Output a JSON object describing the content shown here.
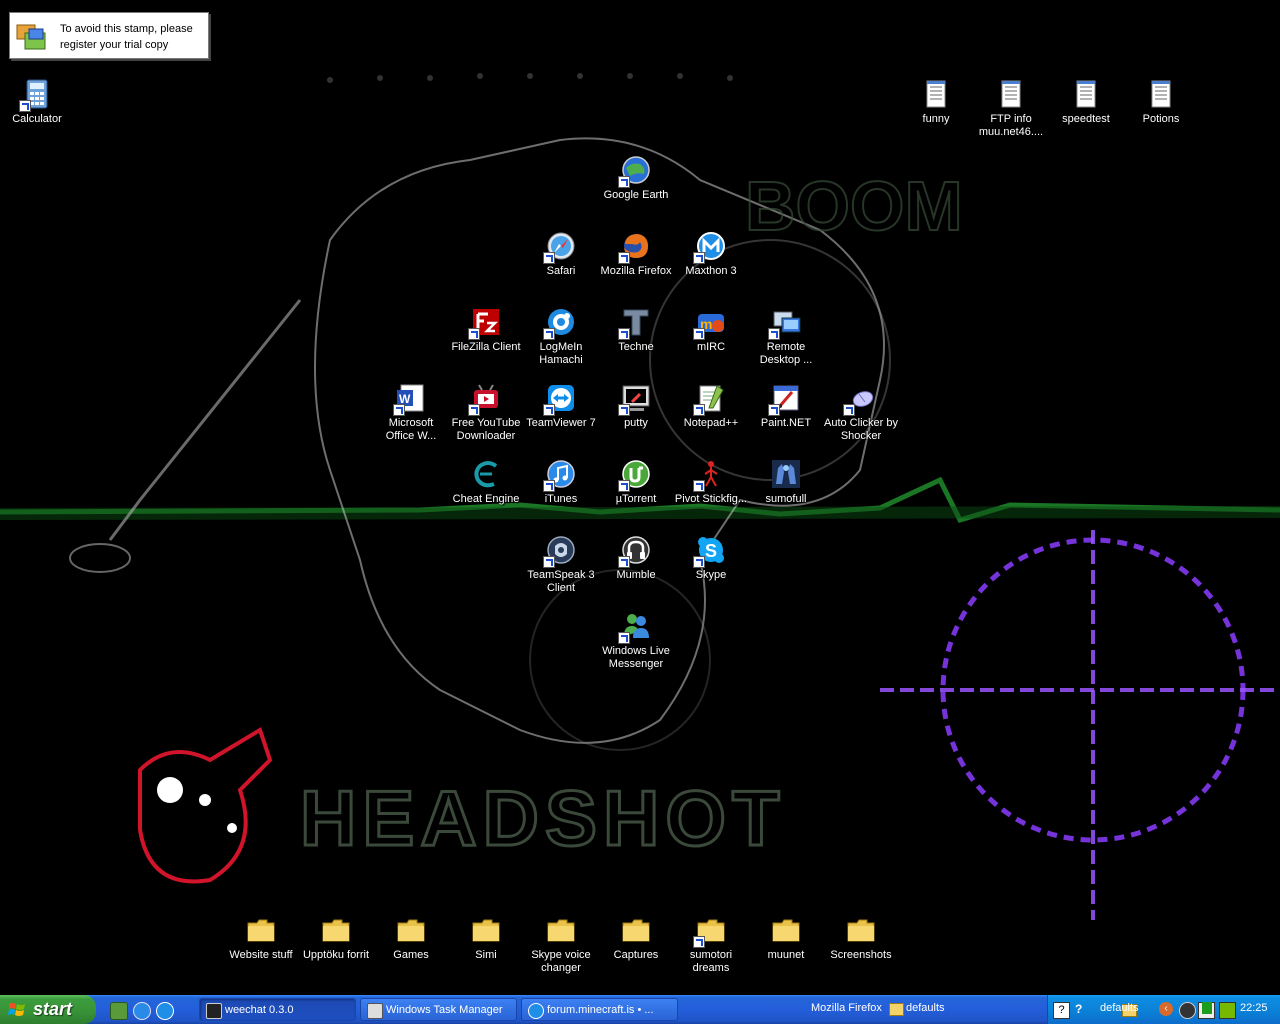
{
  "stamp": {
    "line1": "To avoid this stamp, please",
    "line2": "register your trial copy"
  },
  "desktop": {
    "icons": [
      {
        "label": "Calculator",
        "icon": "calculator-icon",
        "shortcut": true
      },
      {
        "label": "funny",
        "icon": "text-file-icon",
        "shortcut": false
      },
      {
        "label": "FTP info muu.net46....",
        "icon": "text-file-icon",
        "shortcut": false
      },
      {
        "label": "speedtest",
        "icon": "text-file-icon",
        "shortcut": false
      },
      {
        "label": "Potions",
        "icon": "text-file-icon",
        "shortcut": false
      },
      {
        "label": "Google Earth",
        "icon": "google-earth-icon",
        "shortcut": true
      },
      {
        "label": "Safari",
        "icon": "safari-icon",
        "shortcut": true
      },
      {
        "label": "Mozilla Firefox",
        "icon": "firefox-icon",
        "shortcut": true
      },
      {
        "label": "Maxthon 3",
        "icon": "maxthon-icon",
        "shortcut": true
      },
      {
        "label": "FileZilla Client",
        "icon": "filezilla-icon",
        "shortcut": true
      },
      {
        "label": "LogMeIn Hamachi",
        "icon": "hamachi-icon",
        "shortcut": true
      },
      {
        "label": "Techne",
        "icon": "techne-icon",
        "shortcut": true
      },
      {
        "label": "mIRC",
        "icon": "mirc-icon",
        "shortcut": true
      },
      {
        "label": "Remote Desktop ...",
        "icon": "remote-desktop-icon",
        "shortcut": true
      },
      {
        "label": "Microsoft Office W...",
        "icon": "word-icon",
        "shortcut": true
      },
      {
        "label": "Free YouTube Downloader",
        "icon": "youtube-downloader-icon",
        "shortcut": true
      },
      {
        "label": "TeamViewer 7",
        "icon": "teamviewer-icon",
        "shortcut": true
      },
      {
        "label": "putty",
        "icon": "putty-icon",
        "shortcut": true
      },
      {
        "label": "Notepad++",
        "icon": "notepadpp-icon",
        "shortcut": true
      },
      {
        "label": "Paint.NET",
        "icon": "paintnet-icon",
        "shortcut": true
      },
      {
        "label": "Auto Clicker by Shocker",
        "icon": "mouse-icon",
        "shortcut": true
      },
      {
        "label": "Cheat Engine",
        "icon": "cheat-engine-icon",
        "shortcut": false
      },
      {
        "label": "iTunes",
        "icon": "itunes-icon",
        "shortcut": true
      },
      {
        "label": "µTorrent",
        "icon": "utorrent-icon",
        "shortcut": true
      },
      {
        "label": "Pivot Stickfig...",
        "icon": "stickfigure-icon",
        "shortcut": true
      },
      {
        "label": "sumofull",
        "icon": "sumofull-icon",
        "shortcut": false
      },
      {
        "label": "TeamSpeak 3 Client",
        "icon": "teamspeak-icon",
        "shortcut": true
      },
      {
        "label": "Mumble",
        "icon": "mumble-icon",
        "shortcut": true
      },
      {
        "label": "Skype",
        "icon": "skype-icon",
        "shortcut": true
      },
      {
        "label": "Windows Live Messenger",
        "icon": "messenger-icon",
        "shortcut": true
      },
      {
        "label": "Website stuff",
        "icon": "folder-icon",
        "shortcut": false
      },
      {
        "label": "Upptöku forrit",
        "icon": "folder-icon",
        "shortcut": false
      },
      {
        "label": "Games",
        "icon": "folder-icon",
        "shortcut": false
      },
      {
        "label": "Simi",
        "icon": "folder-icon",
        "shortcut": false
      },
      {
        "label": "Skype voice changer",
        "icon": "folder-icon",
        "shortcut": false
      },
      {
        "label": "Captures",
        "icon": "folder-icon",
        "shortcut": false
      },
      {
        "label": "sumotori dreams",
        "icon": "folder-icon",
        "shortcut": true
      },
      {
        "label": "muunet",
        "icon": "folder-icon",
        "shortcut": false
      },
      {
        "label": "Screenshots",
        "icon": "folder-icon",
        "shortcut": false
      }
    ]
  },
  "taskbar": {
    "start_label": "start",
    "tasks": [
      {
        "label": "weechat 0.3.0",
        "icon": "weechat-icon",
        "active": true
      },
      {
        "label": "Windows Task Manager",
        "icon": "task-manager-icon",
        "active": false
      },
      {
        "label": "forum.minecraft.is • ...",
        "icon": "maxthon-icon",
        "active": false
      }
    ],
    "toolbar_firefox": "Mozilla Firefox",
    "toolbar_defaults": "defaults",
    "tray_defaults": "defaults",
    "clock": "22:25"
  },
  "colors": {
    "taskbar_blue": "#245edb",
    "start_green": "#379237",
    "tray_blue": "#0b7fd6",
    "folder_yellow": "#f5d36b"
  }
}
